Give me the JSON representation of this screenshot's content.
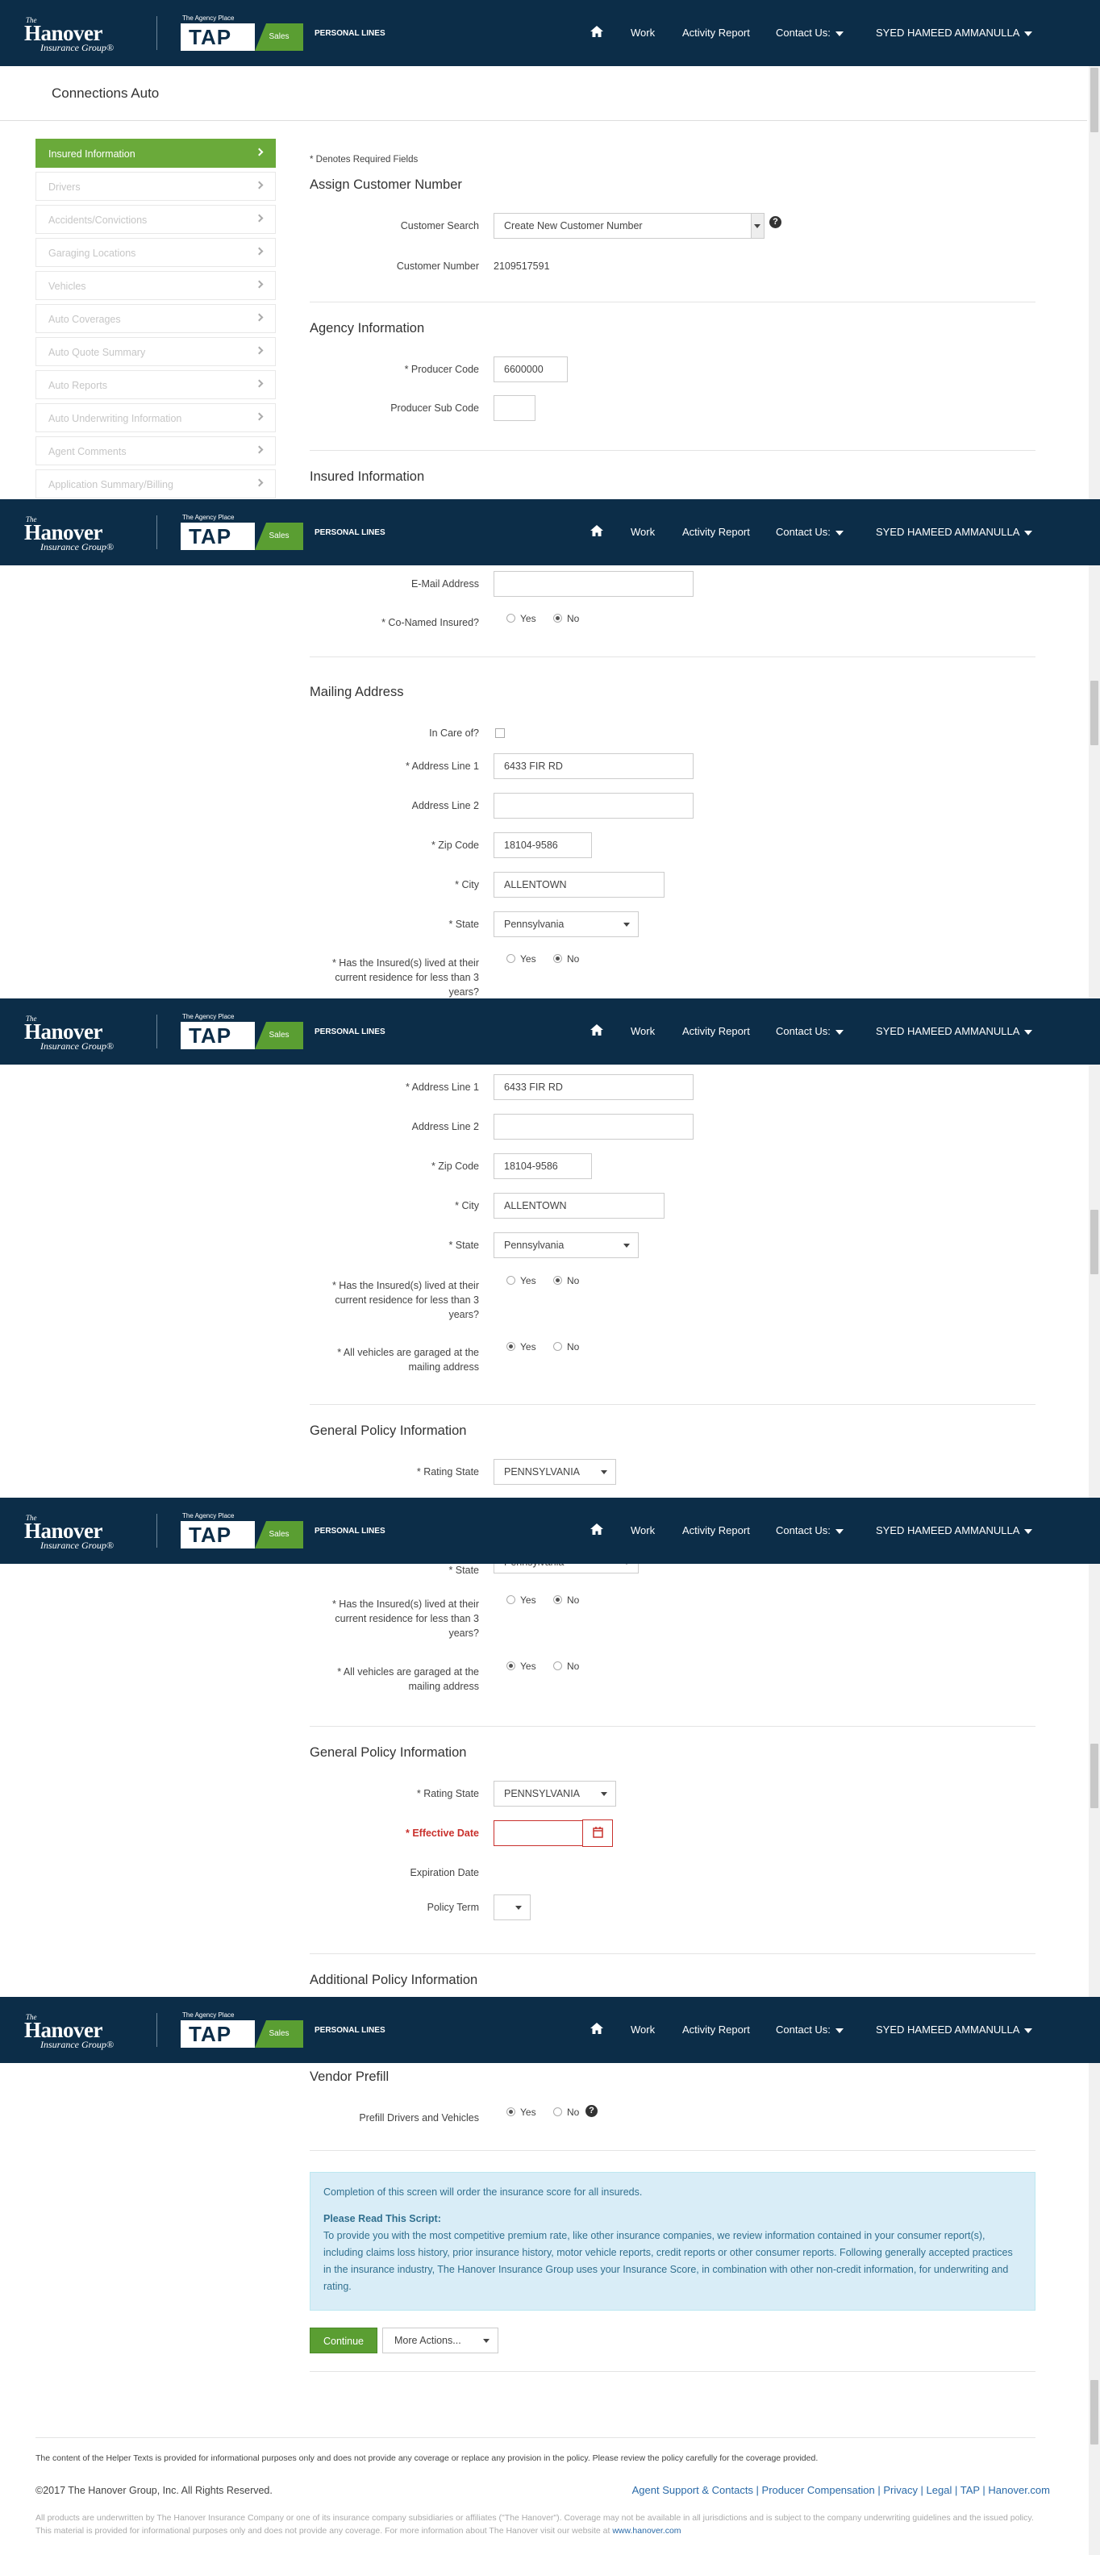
{
  "nav": {
    "logo_the": "The",
    "logo_name": "Hanover",
    "logo_group": "Insurance Group®",
    "tap_tagline": "The Agency Place",
    "tap_name": "TAP",
    "tap_sales": "Sales",
    "personal_lines": "PERSONAL LINES",
    "work": "Work",
    "activity_report": "Activity Report",
    "contact_us": "Contact Us:",
    "user": "SYED HAMEED AMMANULLA"
  },
  "page_title": "Connections Auto",
  "sidebar": {
    "items": [
      {
        "label": "Insured Information"
      },
      {
        "label": "Drivers"
      },
      {
        "label": "Accidents/Convictions"
      },
      {
        "label": "Garaging Locations"
      },
      {
        "label": "Vehicles"
      },
      {
        "label": "Auto Coverages"
      },
      {
        "label": "Auto Quote Summary"
      },
      {
        "label": "Auto Reports"
      },
      {
        "label": "Auto Underwriting Information"
      },
      {
        "label": "Agent Comments"
      },
      {
        "label": "Application Summary/Billing"
      }
    ]
  },
  "form": {
    "required_note": "* Denotes Required Fields",
    "assign_customer_heading": "Assign Customer Number",
    "customer_search_label": "Customer Search",
    "customer_search_value": "Create New Customer Number",
    "customer_number_label": "Customer Number",
    "customer_number_value": "2109517591",
    "agency_heading": "Agency Information",
    "producer_code_label": "* Producer Code",
    "producer_code_value": "6600000",
    "producer_sub_code_label": "Producer Sub Code",
    "insured_heading": "Insured Information",
    "email_label": "E-Mail Address",
    "co_named_label": "* Co-Named Insured?",
    "yes": "Yes",
    "no": "No",
    "mailing_heading": "Mailing Address",
    "in_care_of_label": "In Care of?",
    "address1_label": "* Address Line 1",
    "address1_value": "6433 FIR RD",
    "address2_label": "Address Line 2",
    "zip_label": "* Zip Code",
    "zip_value": "18104-9586",
    "city_label": "* City",
    "city_value": "ALLENTOWN",
    "state_label": "* State",
    "state_value": "Pennsylvania",
    "lived_label": "* Has the Insured(s) lived at their current residence for less than 3 years?",
    "garaged_label": "* All vehicles are garaged at the mailing address",
    "general_heading": "General Policy Information",
    "rating_state_label": "* Rating State",
    "rating_state_value": "PENNSYLVANIA",
    "effective_date_label": "* Effective Date",
    "expiration_date_label": "Expiration Date",
    "policy_term_label": "Policy Term",
    "additional_heading": "Additional Policy Information",
    "vendor_heading": "Vendor Prefill",
    "prefill_label": "Prefill Drivers and Vehicles"
  },
  "info_box": {
    "line1": "Completion of this screen will order the insurance score for all insureds.",
    "script_title": "Please Read This Script:",
    "script_body": "To provide you with the most competitive premium rate, like other insurance companies, we review information contained in your consumer report(s), including claims loss history, prior insurance history, motor vehicle reports, credit reports or other consumer reports. Following generally accepted practices in the insurance industry, The Hanover Insurance Group uses your Insurance Score, in combination with other non-credit information, for underwriting and rating."
  },
  "buttons": {
    "continue": "Continue",
    "more_actions": "More Actions..."
  },
  "footer": {
    "helper_note": "The content of the Helper Texts is provided for informational purposes only and does not provide any coverage or replace any provision in the policy. Please review the policy carefully for the coverage provided.",
    "copyright": "©2017 The Hanover Group, Inc. All Rights Reserved.",
    "links": "Agent Support & Contacts | Producer Compensation | Privacy | Legal | TAP | Hanover.com",
    "disclaimer": "All products are underwritten by The Hanover Insurance Company or one of its insurance company subsidiaries or affiliates (\"The Hanover\"). Coverage may not be available in all jurisdictions and is subject to the company underwriting guidelines and the issued policy. This material is provided for informational purposes only and does not provide any coverage. For more information about The Hanover visit our website at",
    "disclaimer_link": "www.hanover.com"
  },
  "colors": {
    "nav_bg": "#0c2d48",
    "accent_green": "#6aaa3a",
    "error_red": "#c9302c",
    "info_bg": "#d9edf7"
  }
}
